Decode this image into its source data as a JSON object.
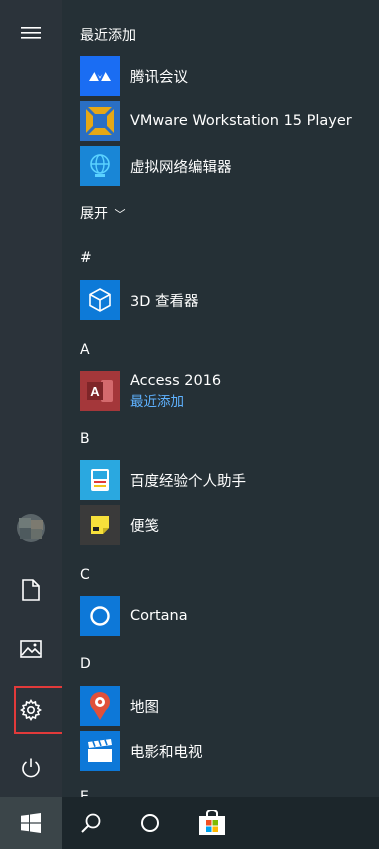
{
  "sections": {
    "recently_added": "最近添加",
    "expand": "展开",
    "expand_chevron": "﹀"
  },
  "letters": [
    "#",
    "A",
    "B",
    "C",
    "D",
    "E"
  ],
  "recent_apps": [
    {
      "name": "腾讯会议",
      "icon": "tencent-meeting-icon",
      "color": "#1a6df3"
    },
    {
      "name": "VMware Workstation 15 Player",
      "icon": "vmware-icon",
      "color": "#2a6fc4"
    },
    {
      "name": "虚拟网络编辑器",
      "icon": "globe-icon",
      "color": "#1986d6"
    }
  ],
  "apps": [
    {
      "name": "3D 查看器",
      "icon": "cube-icon",
      "color": "#0d7ad8"
    },
    {
      "name": "Access 2016",
      "subtitle": "最近添加",
      "icon": "access-icon",
      "color": "#a4373a"
    },
    {
      "name": "百度经验个人助手",
      "icon": "baidu-jingyan-icon",
      "color": "#2aa8e0"
    },
    {
      "name": "便笺",
      "icon": "sticky-note-icon",
      "color": "#3a3a3a"
    },
    {
      "name": "Cortana",
      "icon": "cortana-icon",
      "color": "#0d78d8"
    },
    {
      "name": "地图",
      "icon": "map-pin-icon",
      "color": "#0d78d8"
    },
    {
      "name": "电影和电视",
      "icon": "clapperboard-icon",
      "color": "#0d78d8"
    }
  ],
  "rail": [
    "hamburger-icon",
    "user-avatar",
    "document-icon",
    "pictures-icon",
    "settings-icon",
    "power-icon"
  ],
  "taskbar": [
    "windows-logo-icon",
    "search-icon",
    "cortana-circle-icon",
    "store-bag-icon"
  ],
  "colors": {
    "accent": "#0d78d8",
    "link": "#5fb2ff",
    "annotation": "#e23a3a"
  }
}
